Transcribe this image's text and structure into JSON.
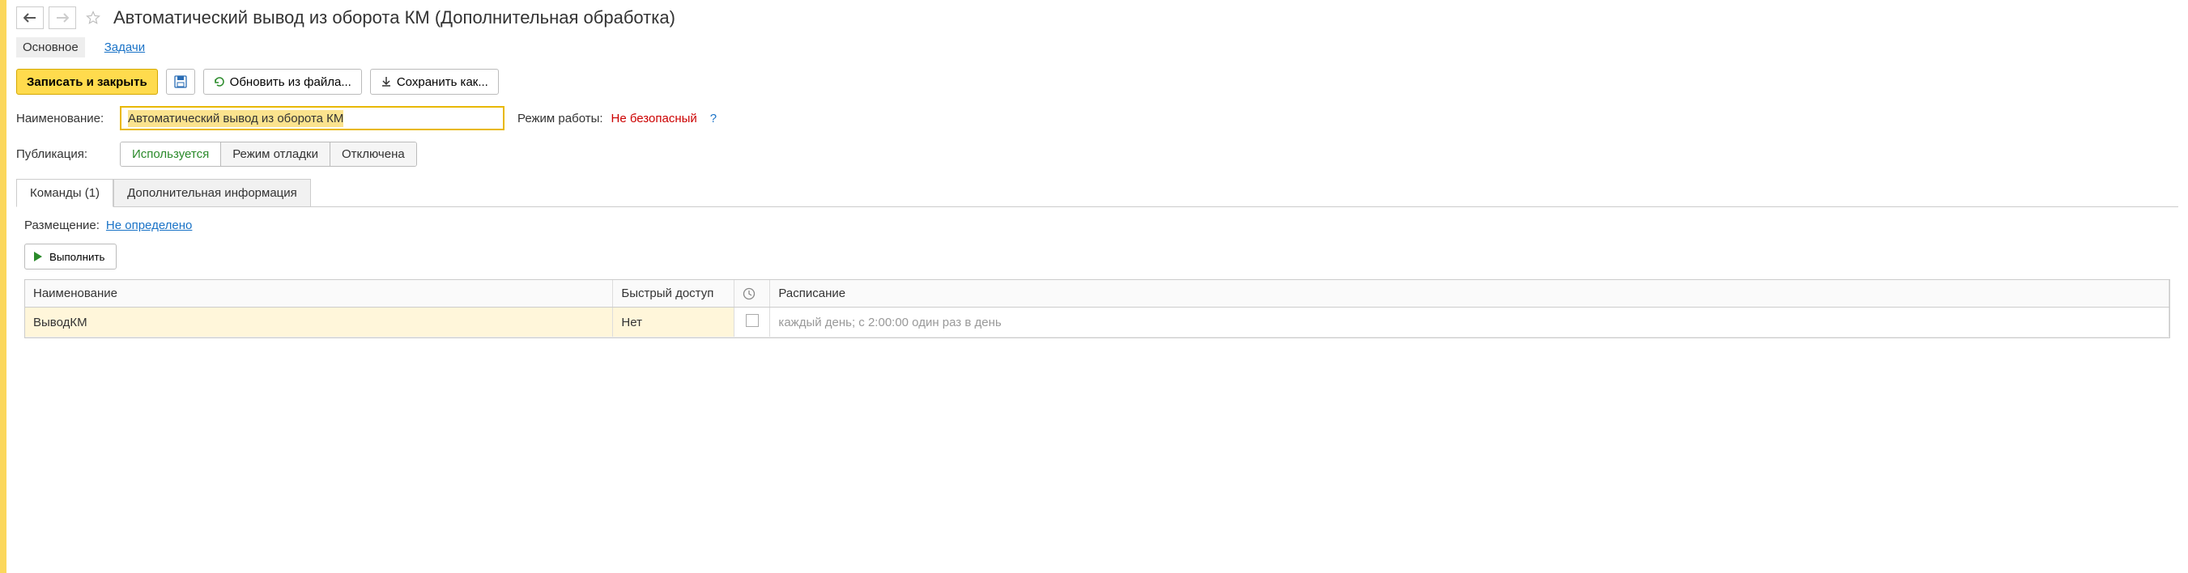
{
  "header": {
    "title": "Автоматический вывод из оборота КМ (Дополнительная обработка)"
  },
  "nav": {
    "main": "Основное",
    "tasks": "Задачи"
  },
  "toolbar": {
    "save_close": "Записать и закрыть",
    "update_from_file": "Обновить из файла...",
    "save_as": "Сохранить как..."
  },
  "form": {
    "name_label": "Наименование:",
    "name_value": "Автоматический вывод из оборота КМ",
    "mode_label": "Режим работы:",
    "mode_value": "Не безопасный",
    "help": "?",
    "publication_label": "Публикация:",
    "pub_opts": {
      "used": "Используется",
      "debug": "Режим отладки",
      "disabled": "Отключена"
    }
  },
  "tabs": {
    "commands": "Команды (1)",
    "extra": "Дополнительная информация"
  },
  "placement": {
    "label": "Размещение:",
    "value": "Не определено"
  },
  "exec_btn": "Выполнить",
  "table": {
    "headers": {
      "name": "Наименование",
      "quick": "Быстрый доступ",
      "schedule": "Расписание"
    },
    "rows": [
      {
        "name": "ВыводКМ",
        "quick": "Нет",
        "schedule": "каждый день; с 2:00:00 один раз в день"
      }
    ]
  }
}
